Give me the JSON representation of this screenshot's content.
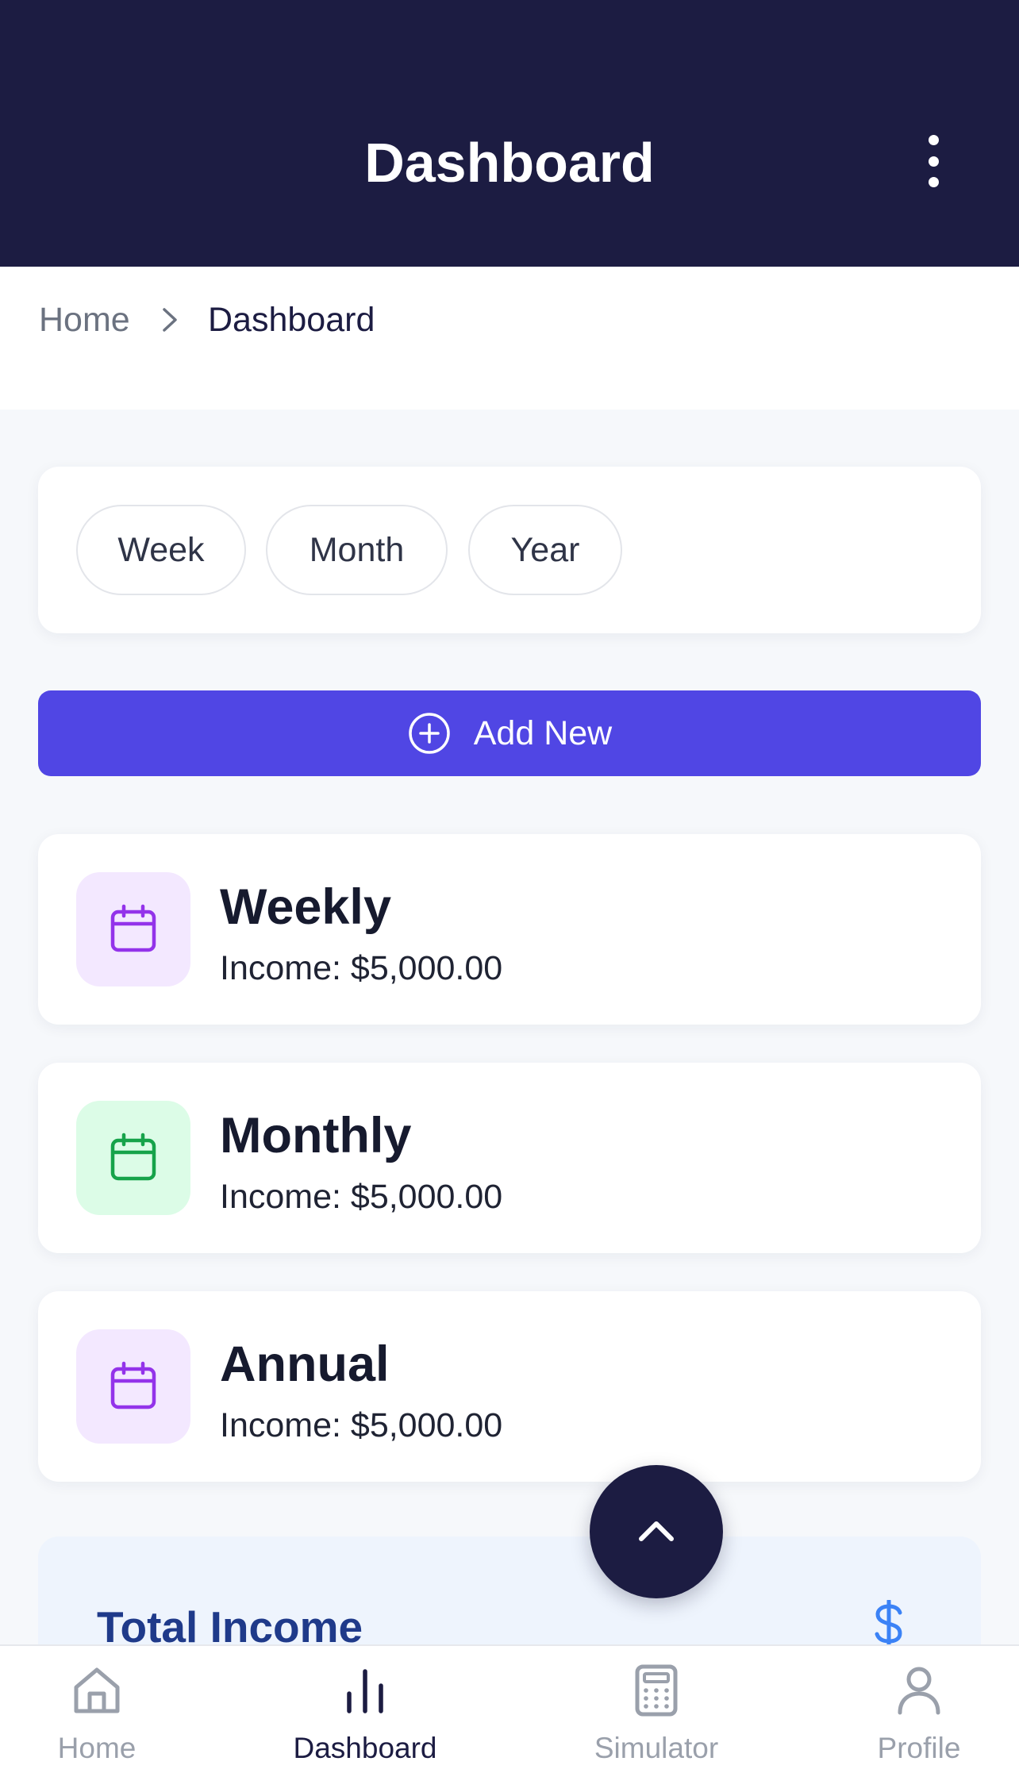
{
  "header": {
    "title": "Dashboard"
  },
  "breadcrumb": {
    "home": "Home",
    "current": "Dashboard"
  },
  "period_filter": {
    "options": [
      "Week",
      "Month",
      "Year"
    ]
  },
  "add_button": {
    "label": "Add New"
  },
  "income_cards": [
    {
      "title": "Weekly",
      "income": "Income: $5,000.00",
      "icon": "calendar-icon",
      "accent": "#9333ea",
      "bg": "#f3e8ff"
    },
    {
      "title": "Monthly",
      "income": "Income: $5,000.00",
      "icon": "calendar-icon",
      "accent": "#16a34a",
      "bg": "#dcfce7"
    },
    {
      "title": "Annual",
      "income": "Income: $5,000.00",
      "icon": "calendar-icon",
      "accent": "#9333ea",
      "bg": "#f3e8ff"
    }
  ],
  "total": {
    "title": "Total Income",
    "icon": "dollar-icon"
  },
  "bottom_nav": [
    {
      "label": "Home",
      "icon": "home-icon",
      "active": false
    },
    {
      "label": "Dashboard",
      "icon": "bar-chart-icon",
      "active": true
    },
    {
      "label": "Simulator",
      "icon": "calculator-icon",
      "active": false
    },
    {
      "label": "Profile",
      "icon": "user-icon",
      "active": false
    }
  ],
  "colors": {
    "header_bg": "#1c1c42",
    "primary": "#5046e4",
    "total_text": "#1f3a8a",
    "dollar": "#3b82f6"
  }
}
